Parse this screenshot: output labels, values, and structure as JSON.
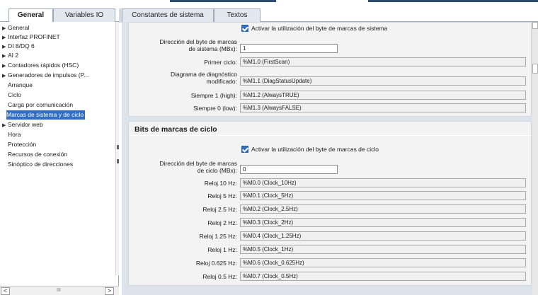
{
  "tabs": [
    {
      "label": "General"
    },
    {
      "label": "Variables IO"
    },
    {
      "label": "Constantes de sistema"
    },
    {
      "label": "Textos"
    }
  ],
  "nav": {
    "items": [
      {
        "label": "General",
        "expandable": true
      },
      {
        "label": "Interfaz PROFINET",
        "expandable": true
      },
      {
        "label": "DI 8/DQ 6",
        "expandable": true
      },
      {
        "label": "AI 2",
        "expandable": true
      },
      {
        "label": "Contadores rápidos (HSC)",
        "expandable": true
      },
      {
        "label": "Generadores de impulsos (P...",
        "expandable": true
      },
      {
        "label": "Arranque",
        "expandable": false
      },
      {
        "label": "Ciclo",
        "expandable": false
      },
      {
        "label": "Carga por comunicación",
        "expandable": false
      },
      {
        "label": "Marcas de sistema y de ciclo",
        "expandable": false,
        "selected": true
      },
      {
        "label": "Servidor web",
        "expandable": true
      },
      {
        "label": "Hora",
        "expandable": false
      },
      {
        "label": "Protección",
        "expandable": false
      },
      {
        "label": "Recursos de conexión",
        "expandable": false
      },
      {
        "label": "Sinóptico de direcciones",
        "expandable": false
      }
    ],
    "scroll_left": "<",
    "scroll_right": ">",
    "scroll_grip": "III"
  },
  "system_memory": {
    "enable_label": "Activar la utilización del byte de marcas de sistema",
    "enabled": true,
    "byte_label_line1": "Dirección del byte de marcas",
    "byte_label_line2": "de sistema (MBx):",
    "byte_value": "1",
    "rows": [
      {
        "label": "Primer ciclo:",
        "value": "%M1.0 (FirstScan)"
      },
      {
        "label_line1": "Diagrama de diagnóstico",
        "label_line2": "modificado:",
        "value": "%M1.1 (DiagStatusUpdate)"
      },
      {
        "label": "Siempre 1 (high):",
        "value": "%M1.2 (AlwaysTRUE)"
      },
      {
        "label": "Siempre 0 (low):",
        "value": "%M1.3 (AlwaysFALSE)"
      }
    ]
  },
  "clock_memory": {
    "title": "Bits de marcas de ciclo",
    "enable_label": "Activar la utilización del byte de marcas de ciclo",
    "enabled": true,
    "byte_label_line1": "Dirección del byte de marcas",
    "byte_label_line2": "de ciclo (MBx):",
    "byte_value": "0",
    "rows": [
      {
        "label": "Reloj 10 Hz:",
        "value": "%M0.0 (Clock_10Hz)"
      },
      {
        "label": "Reloj 5 Hz:",
        "value": "%M0.1 (Clock_5Hz)"
      },
      {
        "label": "Reloj 2.5 Hz:",
        "value": "%M0.2 (Clock_2.5Hz)"
      },
      {
        "label": "Reloj 2 Hz:",
        "value": "%M0.3 (Clock_2Hz)"
      },
      {
        "label": "Reloj 1.25 Hz:",
        "value": "%M0.4 (Clock_1.25Hz)"
      },
      {
        "label": "Reloj 1 Hz:",
        "value": "%M0.5 (Clock_1Hz)"
      },
      {
        "label": "Reloj 0.625 Hz:",
        "value": "%M0.6 (Clock_0.625Hz)"
      },
      {
        "label": "Reloj 0.5 Hz:",
        "value": "%M0.7 (Clock_0.5Hz)"
      }
    ]
  },
  "colors": {
    "selection": "#2f6ec2",
    "panel_bg": "#f3f3f3",
    "area_bg": "#dde3ea"
  }
}
